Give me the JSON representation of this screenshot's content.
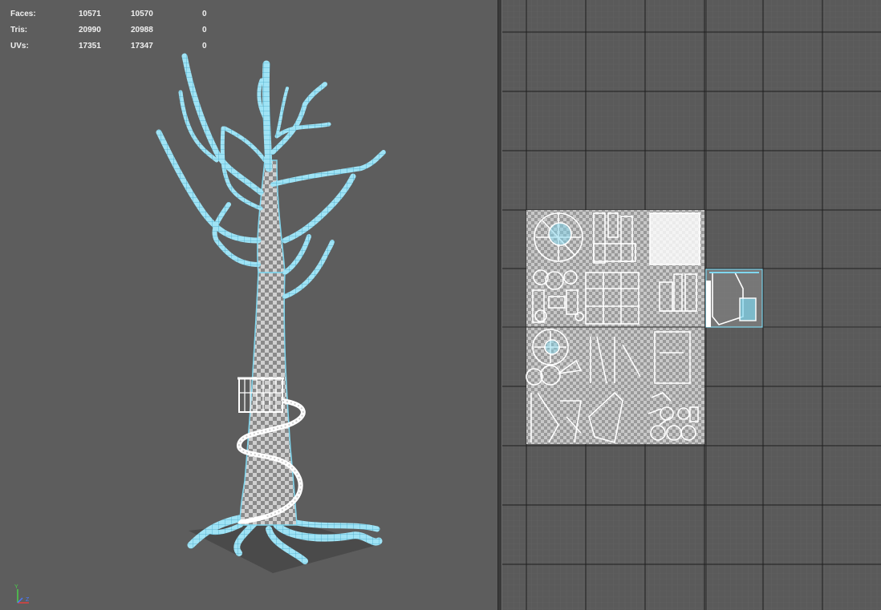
{
  "hud": {
    "rows": [
      {
        "label": "Faces:",
        "v1": "10571",
        "v2": "10570",
        "v3": "0"
      },
      {
        "label": "Tris:",
        "v1": "20990",
        "v2": "20988",
        "v3": "0"
      },
      {
        "label": "UVs:",
        "v1": "17351",
        "v2": "17347",
        "v3": "0"
      }
    ]
  },
  "axis_gizmo": {
    "x": "X",
    "y": "Y",
    "z": "Z"
  },
  "colors": {
    "viewport_bg": "#5d5d5d",
    "wire_cyan": "#7fd6ee",
    "uv_bg": "#5a5a5a",
    "grid_major": "#1e1e1e",
    "checker": "#bdbdbd"
  },
  "icons": {
    "axis": "axis-gizmo-icon"
  }
}
